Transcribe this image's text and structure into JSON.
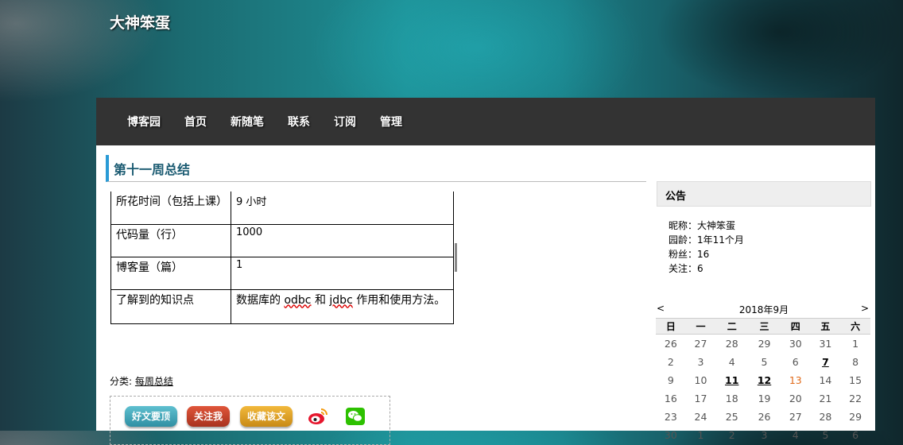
{
  "blog_title": "大神笨蛋",
  "nav": [
    "博客园",
    "首页",
    "新随笔",
    "联系",
    "订阅",
    "管理"
  ],
  "post": {
    "title": "第十一周总结",
    "table": [
      {
        "label": "所花时间（包括上课）",
        "value": "9 小时"
      },
      {
        "label": "代码量（行）",
        "value": "1000"
      },
      {
        "label": "博客量（篇）",
        "value": "1"
      },
      {
        "label": "了解到的知识点",
        "value_parts": [
          "数据库的 ",
          "odbc",
          " 和 ",
          "jdbc",
          " 作用和使用方法。"
        ]
      }
    ],
    "category_label": "分类:",
    "category_link": "每周总结"
  },
  "share": {
    "good_article": "好文要顶",
    "follow_me": "关注我",
    "favorite": "收藏该文",
    "icons": [
      "weibo-icon",
      "wechat-icon"
    ]
  },
  "sidebar": {
    "notice_title": "公告",
    "profile": [
      "昵称：大神笨蛋",
      "园龄：1年11个月",
      "粉丝：16",
      "关注：6"
    ]
  },
  "calendar": {
    "prev": "<",
    "next": ">",
    "month_label": "2018年9月",
    "weekdays": [
      "日",
      "一",
      "二",
      "三",
      "四",
      "五",
      "六"
    ],
    "weeks": [
      [
        "26",
        "27",
        "28",
        "29",
        "30",
        "31",
        "1"
      ],
      [
        "2",
        "3",
        "4",
        "5",
        "6",
        "7",
        "8"
      ],
      [
        "9",
        "10",
        "11",
        "12",
        "13",
        "14",
        "15"
      ],
      [
        "16",
        "17",
        "18",
        "19",
        "20",
        "21",
        "22"
      ],
      [
        "23",
        "24",
        "25",
        "26",
        "27",
        "28",
        "29"
      ],
      [
        "30",
        "1",
        "2",
        "3",
        "4",
        "5",
        "6"
      ]
    ],
    "linked_days": [
      "7",
      "11",
      "12"
    ],
    "today": "13"
  },
  "colors": {
    "accent_bar": "#2a9bd6",
    "nav_bg": "#333333",
    "btn_good": "#3fa5b8",
    "btn_follow": "#c8402a",
    "btn_favorite": "#e0a22a",
    "today": "#e06a1a"
  }
}
